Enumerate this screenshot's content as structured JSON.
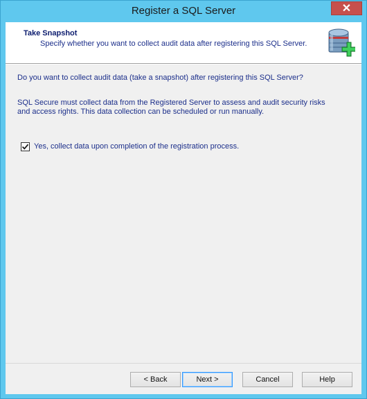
{
  "window": {
    "title": "Register a SQL Server",
    "close_glyph": "✕"
  },
  "header": {
    "title": "Take Snapshot",
    "description": "Specify whether you want to collect audit data after registering this SQL Server.",
    "icon": "server-add-icon"
  },
  "body": {
    "question": "Do you want to collect audit data (take a snapshot) after registering this SQL Server?",
    "info_line1": "SQL Secure must collect data from the Registered Server to assess and audit security risks",
    "info_line2": "and access rights. This data collection can be scheduled or run manually.",
    "checkbox": {
      "label": "Yes, collect data upon completion of the registration process.",
      "checked": true
    }
  },
  "buttons": {
    "back": "< Back",
    "next": "Next >",
    "cancel": "Cancel",
    "help": "Help"
  },
  "colors": {
    "titlebar": "#5fc8ee",
    "close_button": "#c7504c",
    "text_blue": "#1b2e8a"
  }
}
